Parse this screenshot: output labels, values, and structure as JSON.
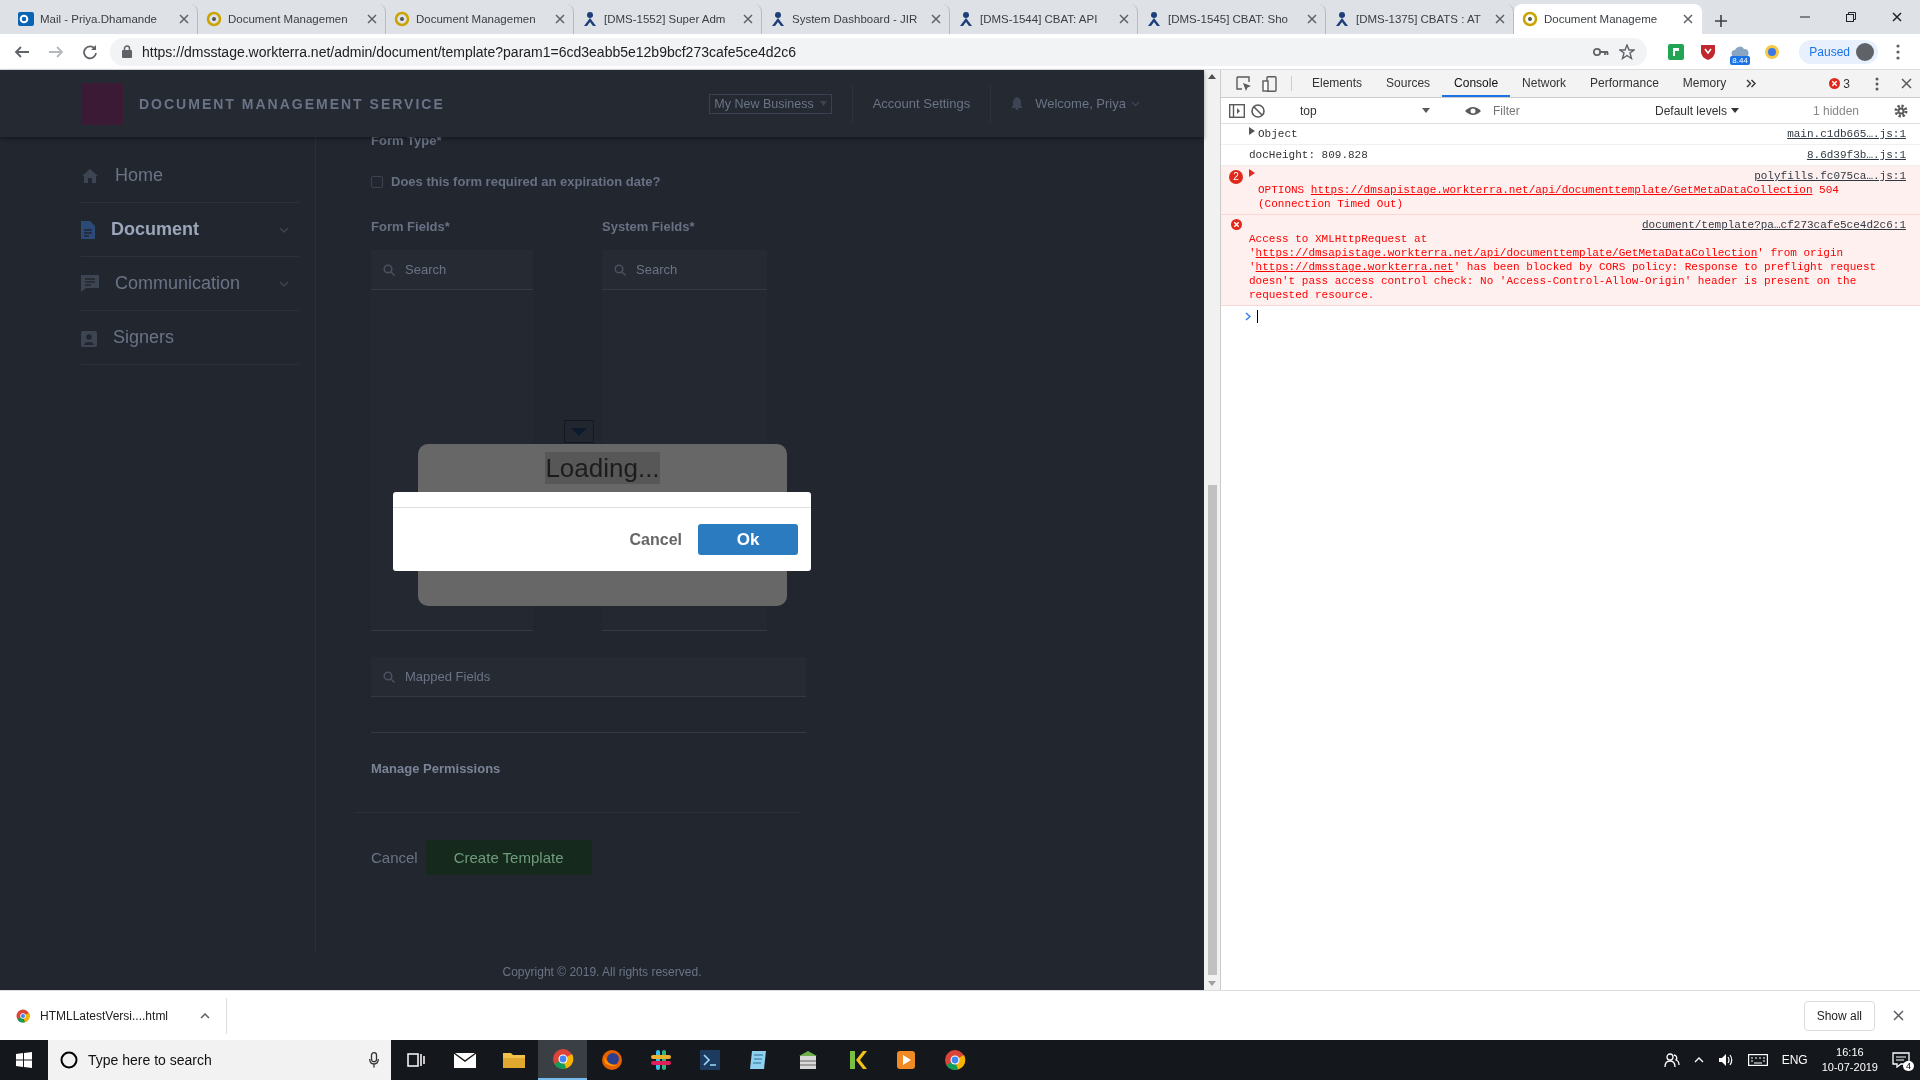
{
  "browser": {
    "tabs": [
      {
        "title": "Mail - Priya.Dhamande",
        "kind": "mail",
        "selected": false
      },
      {
        "title": "Document Managemen",
        "kind": "ring",
        "selected": false
      },
      {
        "title": "Document Managemen",
        "kind": "ring",
        "selected": false
      },
      {
        "title": "[DMS-1552] Super Adm",
        "kind": "figure",
        "selected": false
      },
      {
        "title": "System Dashboard - JIR",
        "kind": "figure",
        "selected": false
      },
      {
        "title": "[DMS-1544] CBAT: API",
        "kind": "figure",
        "selected": false
      },
      {
        "title": "[DMS-1545] CBAT: Sho",
        "kind": "figure",
        "selected": false
      },
      {
        "title": "[DMS-1375] CBATS : AT",
        "kind": "figure",
        "selected": false
      },
      {
        "title": "Document Manageme",
        "kind": "ring",
        "selected": true
      }
    ],
    "url": "https://dmsstage.workterra.net/admin/document/template?param1=6cd3eabb5e12b9bcf273cafe5ce4d2c6",
    "extension_badge": "8.44",
    "profile_button": "Paused"
  },
  "page": {
    "app_title": "DOCUMENT MANAGEMENT SERVICE",
    "business_select": "My New Business",
    "account_settings": "Account Settings",
    "welcome": "Welcome, Priya",
    "sidebar": {
      "items": [
        {
          "label": "Home",
          "kind": "home",
          "expandable": false,
          "selected": false
        },
        {
          "label": "Document",
          "kind": "document",
          "expandable": true,
          "selected": true
        },
        {
          "label": "Communication",
          "kind": "chat",
          "expandable": true,
          "selected": false
        },
        {
          "label": "Signers",
          "kind": "badge",
          "expandable": false,
          "selected": false
        }
      ]
    },
    "form": {
      "form_type_label": "Form Type*",
      "expiration": {
        "label": "Does this form required an expiration date?",
        "checked": false
      },
      "form_fields_label": "Form Fields*",
      "system_fields_label": "System Fields*",
      "form_fields_search": {
        "placeholder": "Search"
      },
      "system_fields_search": {
        "placeholder": "Search"
      },
      "mapped_fields_search": {
        "placeholder": "Mapped Fields"
      },
      "manage_permissions": "Manage Permissions",
      "cancel": "Cancel",
      "create": "Create Template"
    },
    "footer": "Copyright © 2019. All rights reserved.",
    "loading": "Loading...",
    "dialog": {
      "buttons": [
        {
          "label": "Cancel",
          "kind": "secondary"
        },
        {
          "label": "Ok",
          "kind": "primary"
        }
      ]
    }
  },
  "devtools": {
    "tabs": [
      {
        "label": "Elements",
        "selected": false
      },
      {
        "label": "Sources",
        "selected": false
      },
      {
        "label": "Console",
        "selected": true
      },
      {
        "label": "Network",
        "selected": false
      },
      {
        "label": "Performance",
        "selected": false
      },
      {
        "label": "Memory",
        "selected": false
      }
    ],
    "error_count": "3",
    "context": "top",
    "filter": {
      "placeholder": "Filter"
    },
    "levels": "Default levels",
    "hidden": "1 hidden",
    "messages": [
      {
        "kind": "log",
        "expandable": true,
        "parts": [
          {
            "text": "Object",
            "link": false
          }
        ],
        "source": "main.c1db665….js:1"
      },
      {
        "kind": "log",
        "expandable": false,
        "parts": [
          {
            "text": "docHeight: 809.828",
            "link": false
          }
        ],
        "source": "8.6d39f3b….js:1"
      },
      {
        "kind": "error",
        "expandable": true,
        "repeat": "2",
        "parts": [
          {
            "text": "OPTIONS ",
            "link": false
          },
          {
            "text": "https://dmsapistage.workterra.net/api/documenttemplate/GetMetaDataCollection",
            "link": true
          },
          {
            "text": " 504 (Connection Timed Out)",
            "link": false
          }
        ],
        "source": "polyfills.fc075ca….js:1"
      },
      {
        "kind": "error",
        "expandable": false,
        "parts": [
          {
            "text": "Access to XMLHttpRequest at '",
            "link": false
          },
          {
            "text": "https://dmsapistage.workterra.net/api/documenttemplate/GetMetaDataCollection",
            "link": true
          },
          {
            "text": "' from origin '",
            "link": false
          },
          {
            "text": "https://dmsstage.workterra.net",
            "link": true
          },
          {
            "text": "' has been blocked by CORS policy: Response to preflight request doesn't pass access control check: No 'Access-Control-Allow-Origin' header is present on the requested resource.",
            "link": false
          }
        ],
        "source": "document/template?pa…cf273cafe5ce4d2c6:1"
      }
    ]
  },
  "download_bar": {
    "file": "HTMLLatestVersi....html",
    "show_all": "Show all"
  },
  "taskbar": {
    "search": {
      "placeholder": "Type here to search"
    },
    "apps": [
      {
        "kind": "taskview",
        "active": false
      },
      {
        "kind": "mail",
        "active": false
      },
      {
        "kind": "folder",
        "active": false
      },
      {
        "kind": "chrome",
        "active": true
      },
      {
        "kind": "firefox",
        "active": false
      },
      {
        "kind": "slack",
        "active": false
      },
      {
        "kind": "code",
        "active": false
      },
      {
        "kind": "notepad",
        "active": false
      },
      {
        "kind": "archive",
        "active": false
      },
      {
        "kind": "k",
        "active": false
      },
      {
        "kind": "media",
        "active": false
      },
      {
        "kind": "chrome",
        "active": false
      }
    ],
    "language": "ENG",
    "time": "16:16",
    "date": "10-07-2019",
    "notifications": "4"
  }
}
